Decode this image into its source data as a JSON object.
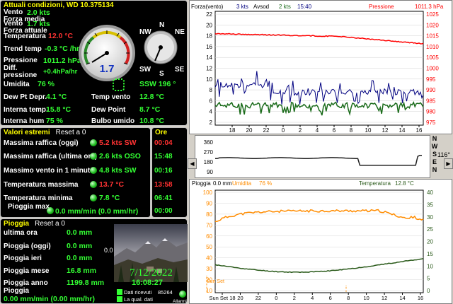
{
  "current": {
    "title": "Attuali condizioni, WD 10.375134",
    "rows": [
      {
        "label": "Vento\nForza media",
        "value": "2.0 kts"
      },
      {
        "label": "Vento\nForza attuale",
        "value": "1.7 kts"
      },
      {
        "label": "Temperatura",
        "value": "12.0 °C"
      },
      {
        "label": "Trend temp",
        "value": "-0.3 °C /hr"
      },
      {
        "label": "Pressione",
        "value": "1011.2 hPa"
      },
      {
        "label": "Diff.\npressione",
        "value": "+0.4hPa/hr"
      },
      {
        "label": "Umidita",
        "value": "76 %"
      }
    ],
    "gauge_value": "1.7",
    "compass_labels": [
      "N",
      "NE",
      "NW",
      "SW",
      "S",
      "SE"
    ],
    "wind_dir": "SSW  196 °",
    "bottom": [
      {
        "label": "Dew Pt Depr.",
        "value": "4.1 °C"
      },
      {
        "label": "Interna temp.",
        "value": "15.8 °C"
      },
      {
        "label": "Interna hum",
        "value": "75 %"
      },
      {
        "label": "Temp vento",
        "value": "12.8 °C"
      },
      {
        "label": "Dew Point",
        "value": "8.7 °C"
      },
      {
        "label": "Bulbo umido",
        "value": "10.8 °C"
      }
    ],
    "side_value": "0.0"
  },
  "extremes": {
    "title": "Valori estremi",
    "reset": "Reset a 0",
    "rows": [
      {
        "label": "Massima raffica (oggi)",
        "value": "5.2 kts  SW",
        "red": true
      },
      {
        "label": "Massima raffica (ultima ora)",
        "value": "2.6 kts OSO",
        "red": false
      },
      {
        "label": "Massimo vento in 1 minuto",
        "value": "4.8 kts  SW",
        "red": false
      },
      {
        "label": "Temperatura massima",
        "value": "13.7 °C",
        "red": true
      },
      {
        "label": "Temperatura minima",
        "value": "7.8 °C",
        "red": false
      },
      {
        "label": "Pioggia max",
        "value": "0.0 mm/min (0.0 mm/hr)",
        "red": false
      }
    ],
    "times_title": "Ore",
    "times": [
      "00:04",
      "15:48",
      "00:16",
      "13:58",
      "06:41",
      "00:00"
    ]
  },
  "rain": {
    "title": "Pioggia",
    "reset": "Reset a 0",
    "rows": [
      {
        "label": "ultima ora",
        "value": "0.0 mm"
      },
      {
        "label": "Pioggia (oggi)",
        "value": "0.0 mm"
      },
      {
        "label": "Pioggia ieri",
        "value": "0.0 mm"
      },
      {
        "label": "Pioggia mese",
        "value": "16.8 mm"
      },
      {
        "label": "Pioggia anno",
        "value": "1199.8 mm"
      },
      {
        "label": "Pioggia",
        "value": "0.00 mm/min (0.00 mm/hr)"
      }
    ],
    "side_value": "0.0",
    "date": "7/12/2022",
    "time": "16:08:27",
    "received_label": "Dati ricevuti",
    "received_count": "85264",
    "quality_label": "La qual. dati",
    "alarm_label": "Allarmi"
  },
  "colors": {
    "green": "#33ff33",
    "red": "#ff3333",
    "yellow": "#ffff00",
    "pressure": "#ff0000",
    "gust": "#000080",
    "avg": "#1a6b1a",
    "temp": "#ff8c00",
    "hum": "#2a5a1a"
  },
  "chart1": {
    "header": {
      "a": "Forza(vento)",
      "a_val": "3 kts",
      "b": "Avsod",
      "b_val": "2 kts",
      "time": "15:40",
      "c": "Pressione",
      "c_val": "1011.3 hPa"
    },
    "left_ticks": [
      "22",
      "20",
      "18",
      "16",
      "14",
      "12",
      "10",
      "8",
      "6",
      "4",
      "2"
    ],
    "right_ticks": [
      "1025",
      "1020",
      "1015",
      "1010",
      "1005",
      "1000",
      "995",
      "990",
      "985",
      "980",
      "975"
    ],
    "x_ticks": [
      "18",
      "20",
      "22",
      "0",
      "2",
      "4",
      "6",
      "8",
      "10",
      "12",
      "14",
      "16"
    ]
  },
  "chart2": {
    "left_ticks": [
      "360",
      "270",
      "180",
      "90"
    ],
    "compass": [
      "N",
      "W",
      "S",
      "E",
      "N"
    ],
    "dir_value": "116°"
  },
  "chart3": {
    "header": {
      "a": "Pioggia",
      "a_val": "0.0 mm",
      "b": "Umidita",
      "b_val": "76 %",
      "c": "Temperatura",
      "c_val": "12.8 °C"
    },
    "left_ticks": [
      "100",
      "90",
      "80",
      "70",
      "60",
      "50",
      "40",
      "30",
      "20",
      "10"
    ],
    "right_ticks": [
      "40",
      "35",
      "30",
      "25",
      "20",
      "15",
      "10",
      "5",
      "0"
    ],
    "x_ticks": [
      "Sun Set 18",
      "20",
      "22",
      "0",
      "2",
      "4",
      "6",
      "8",
      "10",
      "12",
      "14",
      "16"
    ],
    "sunset_label": "Sun Set"
  }
}
